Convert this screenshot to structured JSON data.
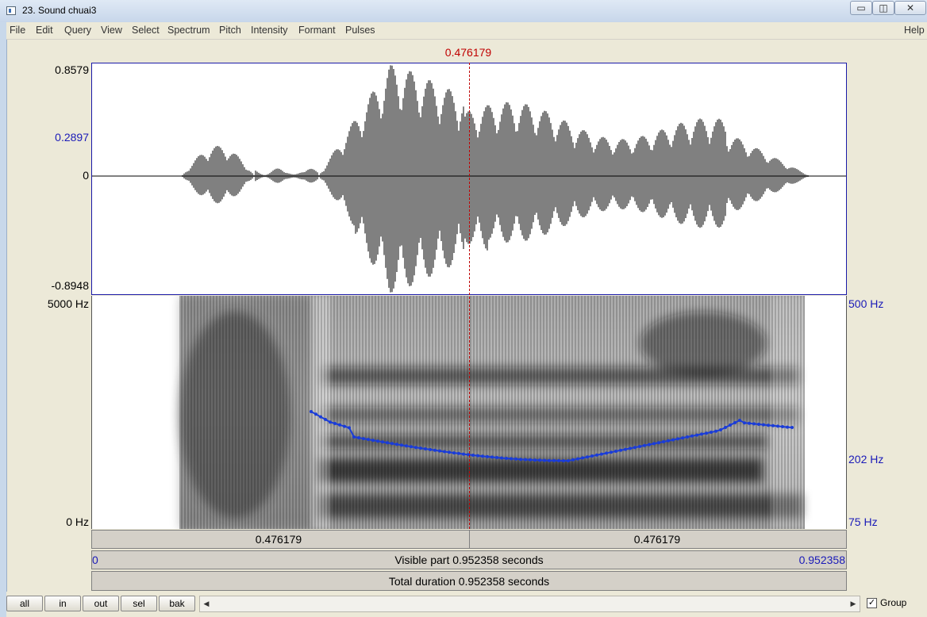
{
  "window": {
    "title": "23. Sound chuai3",
    "controls": {
      "minimize": "▭",
      "restore": "◫",
      "close": "✕"
    }
  },
  "menu": {
    "items": [
      "File",
      "Edit",
      "Query",
      "View",
      "Select",
      "Spectrum",
      "Pitch",
      "Intensity",
      "Formant",
      "Pulses"
    ],
    "help": "Help"
  },
  "cursor": {
    "time": "0.476179"
  },
  "waveform": {
    "max": "0.8579",
    "level": "0.2897",
    "zero": "0",
    "min": "-0.8948"
  },
  "spectrogram": {
    "freq_max": "5000 Hz",
    "freq_min": "0 Hz",
    "pitch_top": "500 Hz",
    "pitch_mid": "202 Hz",
    "pitch_bottom": "75 Hz"
  },
  "time_bars": {
    "left_segment": "0.476179",
    "right_segment": "0.476179",
    "visible_start": "0",
    "visible_label": "Visible part 0.952358 seconds",
    "visible_end": "0.952358",
    "total_label": "Total duration 0.952358 seconds"
  },
  "toolbar": {
    "all": "all",
    "in": "in",
    "out": "out",
    "sel": "sel",
    "bak": "bak",
    "group": "Group",
    "group_checked": true
  },
  "colors": {
    "cursor": "#c00000",
    "pitch_curve": "#1a3cd8",
    "axis_blue": "#1a1ab8"
  }
}
